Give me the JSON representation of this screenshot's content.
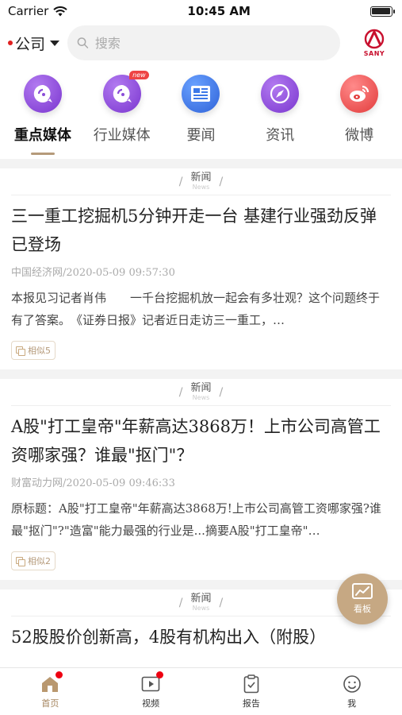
{
  "status_bar": {
    "carrier": "Carrier",
    "time": "10:45 AM"
  },
  "header": {
    "company_label": "公司",
    "search_placeholder": "搜索",
    "logo_text": "SANY"
  },
  "categories": [
    {
      "label": "重点媒体",
      "active": true,
      "color": "#8a4cd8"
    },
    {
      "label": "行业媒体",
      "active": false,
      "badge": "new",
      "color": "#8a4cd8"
    },
    {
      "label": "要闻",
      "active": false,
      "color": "#3d78e8"
    },
    {
      "label": "资讯",
      "active": false,
      "color": "#8a4cd8"
    },
    {
      "label": "微博",
      "active": false,
      "color": "#ef4b4b"
    }
  ],
  "articles": [
    {
      "tag_cn": "新闻",
      "tag_en": "News",
      "title": "三一重工挖掘机5分钟开走一台 基建行业强劲反弹已登场",
      "meta": "中国经济网/2020-05-09 09:57:30",
      "summary": "本报见习记者肖伟　　一千台挖掘机放一起会有多壮观？这个问题终于有了答案。　《证券日报》记者近日走访三一重工，…",
      "similar": "相似5"
    },
    {
      "tag_cn": "新闻",
      "tag_en": "News",
      "title": "A股\"打工皇帝\"年薪高达3868万！上市公司高管工资哪家强？谁最\"抠门\"？",
      "meta": "财富动力网/2020-05-09 09:46:33",
      "summary": "原标题：A股\"打工皇帝\"年薪高达3868万!上市公司高管工资哪家强?谁最\"抠门\"?\"造富\"能力最强的行业是...摘要A股\"打工皇帝\"…",
      "similar": "相似2"
    },
    {
      "tag_cn": "新闻",
      "tag_en": "News",
      "title": "52股股价创新高，4股有机构出入（附股）",
      "meta": "",
      "summary": "",
      "similar": ""
    }
  ],
  "fab": {
    "label": "看板"
  },
  "tabs": [
    {
      "label": "首页",
      "active": true,
      "dot": true
    },
    {
      "label": "视频",
      "active": false,
      "dot": true
    },
    {
      "label": "报告",
      "active": false,
      "dot": false
    },
    {
      "label": "我",
      "active": false,
      "dot": false
    }
  ],
  "colors": {
    "accent": "#b59a7a",
    "brand_red": "#c8102e"
  }
}
